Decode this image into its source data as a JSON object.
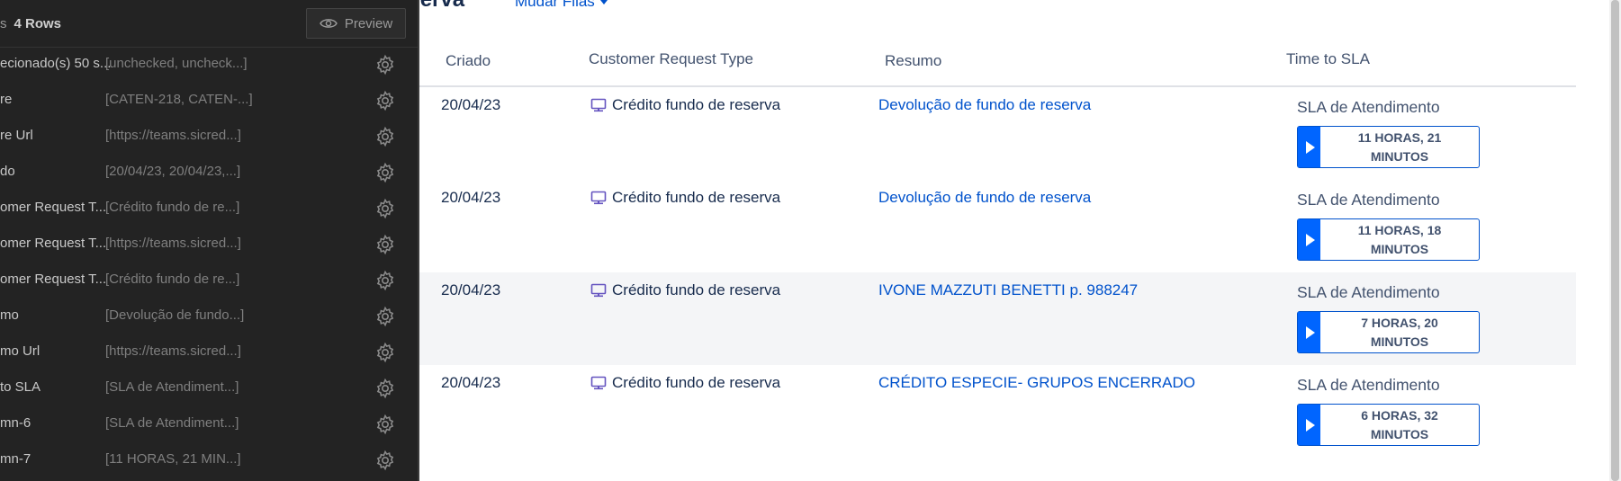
{
  "page": {
    "title": "eserva",
    "queue_switch": "Mudar Filas",
    "columns": [
      "Criado",
      "Customer Request Type",
      "Resumo",
      "Time to SLA"
    ],
    "rows": [
      {
        "date": "20/04/23",
        "type": "Crédito fundo de reserva",
        "summary": "Devolução de fundo de reserva",
        "sla_name": "SLA de Atendimento",
        "sla_line1": "11 HORAS, 21",
        "sla_line2": "MINUTOS"
      },
      {
        "date": "20/04/23",
        "type": "Crédito fundo de reserva",
        "summary": "Devolução de fundo de reserva",
        "sla_name": "SLA de Atendimento",
        "sla_line1": "11 HORAS, 18",
        "sla_line2": "MINUTOS"
      },
      {
        "date": "20/04/23",
        "type": "Crédito fundo de reserva",
        "summary": "IVONE MAZZUTI BENETTI p. 988247",
        "sla_name": "SLA de Atendimento",
        "sla_line1": "7 HORAS, 20",
        "sla_line2": "MINUTOS"
      },
      {
        "date": "20/04/23",
        "type": "Crédito fundo de reserva",
        "summary": "CRÉDITO ESPECIE- GRUPOS ENCERRADO",
        "sla_name": "SLA de Atendimento",
        "sla_line1": "6 HORAS, 32",
        "sla_line2": "MINUTOS"
      }
    ]
  },
  "panel": {
    "rows_prefix": "s",
    "rows_count": "4 Rows",
    "preview_label": "Preview",
    "columns": [
      {
        "name": "ecionado(s) 50 s...",
        "value": "[unchecked, uncheck...]"
      },
      {
        "name": "re",
        "value": "[CATEN-218, CATEN-...]"
      },
      {
        "name": "re Url",
        "value": "[https://teams.sicred...]"
      },
      {
        "name": "do",
        "value": "[20/04/23, 20/04/23,...]"
      },
      {
        "name": "omer Request T...",
        "value": "[Crédito fundo de re...]"
      },
      {
        "name": "omer Request T...",
        "value": "[https://teams.sicred...]"
      },
      {
        "name": "omer Request T...",
        "value": "[Crédito fundo de re...]"
      },
      {
        "name": "mo",
        "value": "[Devolução de fundo...]"
      },
      {
        "name": "mo Url",
        "value": "[https://teams.sicred...]"
      },
      {
        "name": "to SLA",
        "value": "[SLA de Atendiment...]"
      },
      {
        "name": "mn-6",
        "value": "[SLA de Atendiment...]"
      },
      {
        "name": "mn-7",
        "value": "[11 HORAS, 21 MIN...]"
      }
    ]
  },
  "colors": {
    "link": "#0052cc",
    "sla_accent": "#0065ff",
    "panel_bg": "#232323"
  },
  "icons": {
    "request_type": "monitor-icon",
    "settings": "gear-icon",
    "preview": "eye-icon",
    "timer": "play-icon"
  }
}
